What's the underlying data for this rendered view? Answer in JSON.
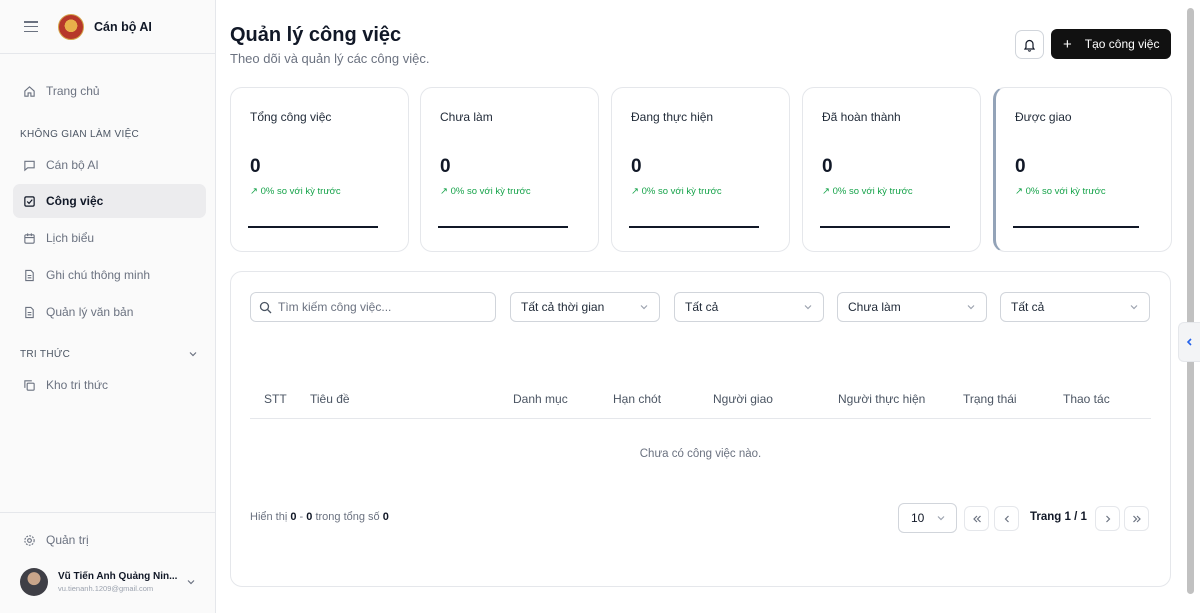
{
  "app": {
    "name": "Cán bộ AI"
  },
  "sidebar": {
    "home": "Trang chủ",
    "workspace_label": "KHÔNG GIAN LÀM VIỆC",
    "workspace_items": [
      "Cán bộ AI",
      "Công việc",
      "Lịch biểu",
      "Ghi chú thông minh",
      "Quản lý văn bản"
    ],
    "knowledge_label": "TRI THỨC",
    "knowledge_items": [
      "Kho tri thức"
    ],
    "admin": "Quản trị",
    "user": {
      "name": "Vũ Tiến Anh Quảng Nin...",
      "email": "vu.tienanh.1209@gmail.com"
    }
  },
  "header": {
    "title": "Quản lý công việc",
    "subtitle": "Theo dõi và quản lý các công việc.",
    "create_label": "Tạo công việc"
  },
  "stats": [
    {
      "label": "Tổng công việc",
      "value": "0",
      "trend": "0% so với kỳ trước"
    },
    {
      "label": "Chưa làm",
      "value": "0",
      "trend": "0% so với kỳ trước"
    },
    {
      "label": "Đang thực hiện",
      "value": "0",
      "trend": "0% so với kỳ trước"
    },
    {
      "label": "Đã hoàn thành",
      "value": "0",
      "trend": "0% so với kỳ trước"
    },
    {
      "label": "Được giao",
      "value": "0",
      "trend": "0% so với kỳ trước"
    }
  ],
  "filters": {
    "search_placeholder": "Tìm kiếm công việc...",
    "time": "Tất cả thời gian",
    "category": "Tất cả",
    "status": "Chưa làm",
    "assignee": "Tất cả"
  },
  "table": {
    "columns": [
      "STT",
      "Tiêu đề",
      "Danh mục",
      "Hạn chót",
      "Người giao",
      "Người thực hiện",
      "Trạng thái",
      "Thao tác"
    ],
    "empty": "Chưa có công việc nào."
  },
  "pagination": {
    "prefix": "Hiển thị ",
    "from": "0",
    "sep": " - ",
    "to": "0",
    "mid": " trong tổng số ",
    "total": "0",
    "page_size": "10",
    "page_info": "Trang 1 / 1"
  },
  "colors": {
    "accent": "#111111",
    "trend": "#16a34a",
    "highlight_border": "#93a3b8"
  },
  "icons": [
    "menu-icon",
    "home-icon",
    "chat-icon",
    "checkbox-icon",
    "calendar-icon",
    "file-icon",
    "copy-icon",
    "gear-icon",
    "bell-icon",
    "plus-icon",
    "search-icon",
    "chevron-down-icon",
    "chevron-left-icon",
    "chevron-right-icon",
    "arrow-up-right-icon"
  ]
}
